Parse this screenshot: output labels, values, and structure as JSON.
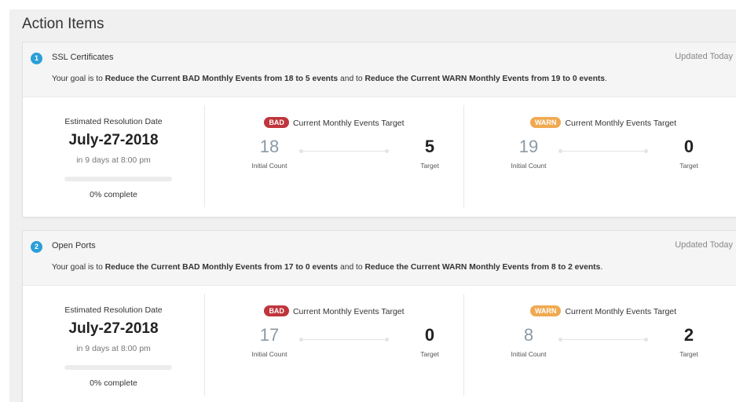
{
  "page": {
    "title": "Action Items"
  },
  "colors": {
    "accent": "#2a9fd8",
    "bad": "#c0353c",
    "warn": "#f0a950"
  },
  "cards": [
    {
      "number": "1",
      "title": "SSL Certificates",
      "updated": "Updated Today",
      "goal": {
        "prefix": "Your goal is to ",
        "bad_goal": "Reduce the Current BAD Monthly Events from 18 to 5 events",
        "middle": " and to ",
        "warn_goal": "Reduce the Current WARN Monthly Events from 19 to 0 events",
        "suffix": "."
      },
      "resolution": {
        "label": "Estimated Resolution Date",
        "date": "July-27-2018",
        "sub": "in 9 days at 8:00 pm",
        "progress": 0,
        "progress_label": "0% complete"
      },
      "bad": {
        "badge": "BAD",
        "label": "Current Monthly Events Target",
        "initial": "18",
        "initial_label": "Initial Count",
        "target": "5",
        "target_label": "Target"
      },
      "warn": {
        "badge": "WARN",
        "label": "Current Monthly Events Target",
        "initial": "19",
        "initial_label": "Initial Count",
        "target": "0",
        "target_label": "Target"
      }
    },
    {
      "number": "2",
      "title": "Open Ports",
      "updated": "Updated Today",
      "goal": {
        "prefix": "Your goal is to ",
        "bad_goal": "Reduce the Current BAD Monthly Events from 17 to 0 events",
        "middle": " and to ",
        "warn_goal": "Reduce the Current WARN Monthly Events from 8 to 2 events",
        "suffix": "."
      },
      "resolution": {
        "label": "Estimated Resolution Date",
        "date": "July-27-2018",
        "sub": "in 9 days at 8:00 pm",
        "progress": 0,
        "progress_label": "0% complete"
      },
      "bad": {
        "badge": "BAD",
        "label": "Current Monthly Events Target",
        "initial": "17",
        "initial_label": "Initial Count",
        "target": "0",
        "target_label": "Target"
      },
      "warn": {
        "badge": "WARN",
        "label": "Current Monthly Events Target",
        "initial": "8",
        "initial_label": "Initial Count",
        "target": "2",
        "target_label": "Target"
      }
    }
  ]
}
